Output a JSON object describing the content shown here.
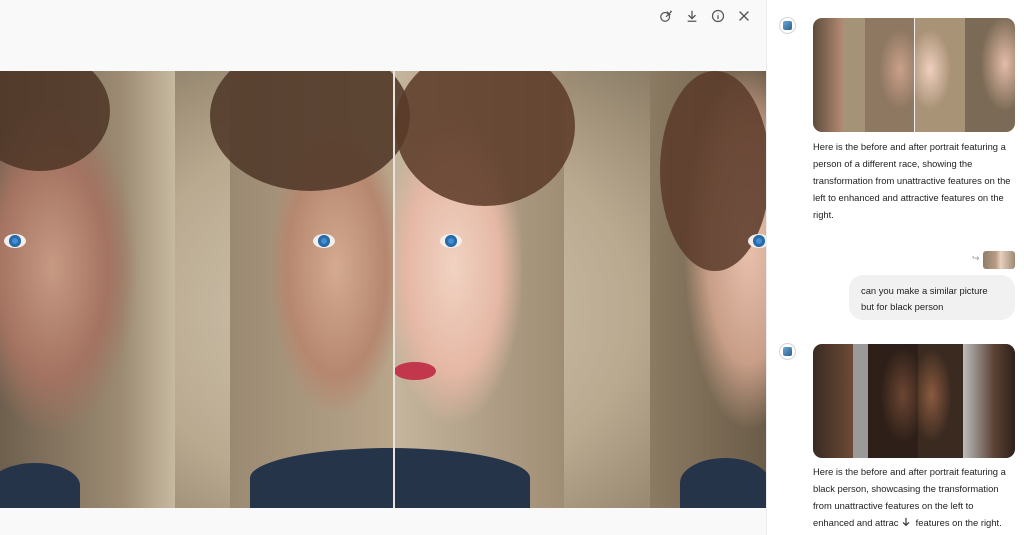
{
  "viewer": {
    "toolbar": {
      "icons": [
        "edit-image-icon",
        "download-icon",
        "info-icon",
        "close-icon"
      ]
    },
    "image_alt": "Before and after portrait comparison"
  },
  "chat": {
    "messages": [
      {
        "role": "assistant",
        "text": "Here is the before and after portrait featuring a person of a different race, showing the transformation from unattractive features on the left to enhanced and attractive features on the right."
      },
      {
        "role": "user",
        "text": "can you make a similar picture but for black person"
      },
      {
        "role": "assistant",
        "text": "Here is the before and after portrait featuring a black person, showcasing the transformation from unattractive features on the left to enhanced and attractive features on the right."
      }
    ]
  },
  "colors": {
    "accent": "#3f8ed6",
    "bubble": "#f1f1f1"
  }
}
